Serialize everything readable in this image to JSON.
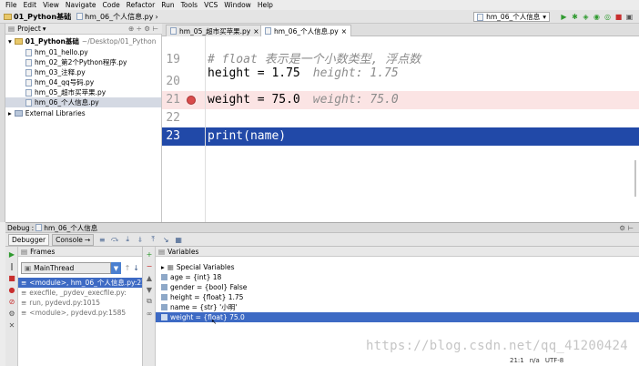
{
  "menu": [
    "File",
    "Edit",
    "View",
    "Navigate",
    "Code",
    "Refactor",
    "Run",
    "Tools",
    "VCS",
    "Window",
    "Help"
  ],
  "breadcrumbs": [
    "01_Python基础",
    "hm_06_个人信息.py"
  ],
  "run_config": "hm_06_个人信息",
  "project_panel": {
    "title": "Project",
    "root_name": "01_Python基础",
    "root_path": "~/Desktop/01_Python",
    "files": [
      "hm_01_hello.py",
      "hm_02_第2个Python程序.py",
      "hm_03_注释.py",
      "hm_04_qq号码.py",
      "hm_05_超市买苹果.py",
      "hm_06_个人信息.py"
    ],
    "external": "External Libraries"
  },
  "editor_tabs": [
    "hm_05_超市买苹果.py",
    "hm_06_个人信息.py"
  ],
  "code_lines": [
    {
      "num": "19",
      "code": "# float 表示是一个小数类型, 浮点数",
      "hint": ""
    },
    {
      "num": "",
      "code": "height = 1.75",
      "hint": "height: 1.75"
    },
    {
      "num": "20",
      "code": "",
      "hint": ""
    },
    {
      "num": "21",
      "code": "weight = 75.0",
      "hint": "weight: 75.0"
    },
    {
      "num": "22",
      "code": "",
      "hint": ""
    },
    {
      "num": "23",
      "code": "print(name)",
      "hint": ""
    }
  ],
  "debug": {
    "title": "Debug",
    "config": "hm_06_个人信息",
    "tabs": [
      "Debugger",
      "Console"
    ],
    "frames_title": "Frames",
    "thread": "MainThread",
    "frames": [
      "<module>, hm_06_个人信息.py:23",
      "execfile, _pydev_execfile.py:",
      "run, pydevd.py:1015",
      "<module>, pydevd.py:1585"
    ],
    "variables_title": "Variables",
    "special": "Special Variables",
    "variables": [
      "age = {int} 18",
      "gender = {bool} False",
      "height = {float} 1.75",
      "name = {str} '小明'",
      "weight = {float} 75.0"
    ]
  },
  "watermark": "https://blog.csdn.net/qq_41200424",
  "status": {
    "position": "21:1",
    "na": "n/a",
    "encoding": "UTF-8"
  },
  "colors": {
    "accent": "#2149a8",
    "selection": "#3d6ac4",
    "breakpoint": "#d94b4b",
    "breakpoint_line": "#fbe4e4"
  }
}
